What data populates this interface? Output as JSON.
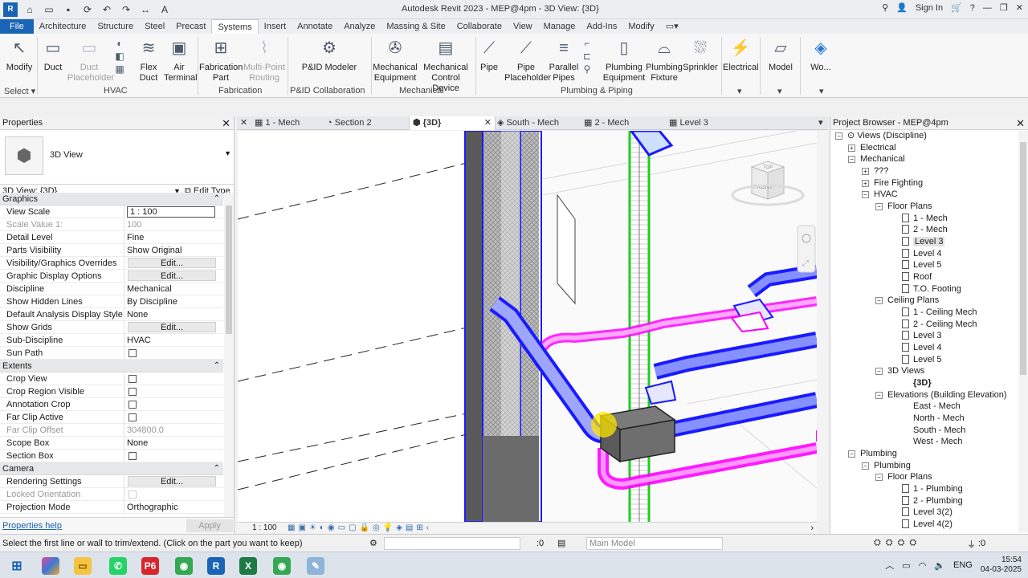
{
  "titlebar": {
    "title": "Autodesk Revit 2023 - MEP@4pm - 3D View: {3D}",
    "sign_in": "Sign In"
  },
  "tabs": [
    "File",
    "Architecture",
    "Structure",
    "Steel",
    "Precast",
    "Systems",
    "Insert",
    "Annotate",
    "Analyze",
    "Massing & Site",
    "Collaborate",
    "View",
    "Manage",
    "Add-Ins",
    "Modify"
  ],
  "active_tab": "Systems",
  "ribbon": {
    "modify": "Modify",
    "duct": "Duct",
    "duct_placeholder": "Duct Placeholder",
    "flex_duct": "Flex Duct",
    "air_terminal": "Air Terminal",
    "fabrication_part": "Fabrication Part",
    "multi_point_routing": "Multi-Point Routing",
    "pid_modeler": "P&ID Modeler",
    "mechanical_equipment": "Mechanical Equipment",
    "mechanical_control_device": "Mechanical Control Device",
    "pipe": "Pipe",
    "pipe_placeholder": "Pipe Placeholder",
    "parallel_pipes": "Parallel Pipes",
    "plumbing_equipment": "Plumbing Equipment",
    "plumbing_fixture": "Plumbing Fixture",
    "sprinkler": "Sprinkler",
    "electrical": "Electrical",
    "model": "Model",
    "work": "Wo...",
    "panels": {
      "select": "Select",
      "hvac": "HVAC",
      "fabrication": "Fabrication",
      "pid": "P&ID Collaboration",
      "mechanical": "Mechanical",
      "plumbing": "Plumbing & Piping"
    }
  },
  "properties": {
    "title": "Properties",
    "type_name": "3D View",
    "selector": "3D View: {3D}",
    "edit_type": "Edit Type",
    "groups": {
      "graphics": "Graphics",
      "extents": "Extents",
      "camera": "Camera"
    },
    "rows": {
      "view_scale": {
        "k": "View Scale",
        "v": "1 : 100"
      },
      "scale_value": {
        "k": "Scale Value    1:",
        "v": "100"
      },
      "detail_level": {
        "k": "Detail Level",
        "v": "Fine"
      },
      "parts_visibility": {
        "k": "Parts Visibility",
        "v": "Show Original"
      },
      "vg_overrides": {
        "k": "Visibility/Graphics Overrides",
        "v": "Edit..."
      },
      "graphic_display": {
        "k": "Graphic Display Options",
        "v": "Edit..."
      },
      "discipline": {
        "k": "Discipline",
        "v": "Mechanical"
      },
      "hidden_lines": {
        "k": "Show Hidden Lines",
        "v": "By Discipline"
      },
      "analysis_style": {
        "k": "Default Analysis Display Style",
        "v": "None"
      },
      "show_grids": {
        "k": "Show Grids",
        "v": "Edit..."
      },
      "sub_discipline": {
        "k": "Sub-Discipline",
        "v": "HVAC"
      },
      "sun_path": {
        "k": "Sun Path"
      },
      "crop_view": {
        "k": "Crop View"
      },
      "crop_region": {
        "k": "Crop Region Visible"
      },
      "annotation_crop": {
        "k": "Annotation Crop"
      },
      "far_clip_active": {
        "k": "Far Clip Active"
      },
      "far_clip_offset": {
        "k": "Far Clip Offset",
        "v": "304800.0"
      },
      "scope_box": {
        "k": "Scope Box",
        "v": "None"
      },
      "section_box": {
        "k": "Section Box"
      },
      "rendering": {
        "k": "Rendering Settings",
        "v": "Edit..."
      },
      "locked_orientation": {
        "k": "Locked Orientation"
      },
      "projection": {
        "k": "Projection Mode",
        "v": "Orthographic"
      }
    },
    "help": "Properties help",
    "apply": "Apply"
  },
  "view_tabs": [
    "1 - Mech",
    "Section 2",
    "{3D}",
    "South - Mech",
    "2 - Mech",
    "Level 3"
  ],
  "view_bar": {
    "scale": "1 : 100"
  },
  "viewcube": {
    "top": "TOP",
    "front": "FRONT"
  },
  "browser": {
    "title": "Project Browser - MEP@4pm",
    "nodes": {
      "views": "Views (Discipline)",
      "electrical": "Electrical",
      "mechanical": "Mechanical",
      "qqq": "???",
      "fire": "Fire Fighting",
      "hvac": "HVAC",
      "floor_plans": "Floor Plans",
      "fp1": "1 - Mech",
      "fp2": "2 - Mech",
      "fp3": "Level 3",
      "fp4": "Level 4",
      "fp5": "Level 5",
      "roof": "Roof",
      "tof": "T.O. Footing",
      "ceiling_plans": "Ceiling Plans",
      "cp1": "1 - Ceiling Mech",
      "cp2": "2 - Ceiling Mech",
      "cp3": "Level 3",
      "cp4": "Level 4",
      "cp5": "Level 5",
      "views3d": "3D Views",
      "v3d": "{3D}",
      "elevations": "Elevations (Building Elevation)",
      "east": "East - Mech",
      "north": "North - Mech",
      "south": "South - Mech",
      "west": "West - Mech",
      "plumbing_root": "Plumbing",
      "plumbing": "Plumbing",
      "pl_floor": "Floor Plans",
      "pl1": "1 - Plumbing",
      "pl2": "2 - Plumbing",
      "pl3": "Level 3(2)",
      "pl4": "Level 4(2)"
    }
  },
  "status": {
    "message": "Select the first line or wall to trim/extend. (Click on the part you want to keep)",
    "zero": ":0",
    "model": "Main Model",
    "zero2": ":0"
  },
  "taskbar": {
    "lang": "ENG",
    "time": "15:54",
    "date": "04-03-2025"
  },
  "colors": {
    "duct_blue": "#1a1aff",
    "pipe_magenta": "#ff00ff",
    "pipe_green": "#22cc22",
    "accent": "#1a64b5"
  }
}
